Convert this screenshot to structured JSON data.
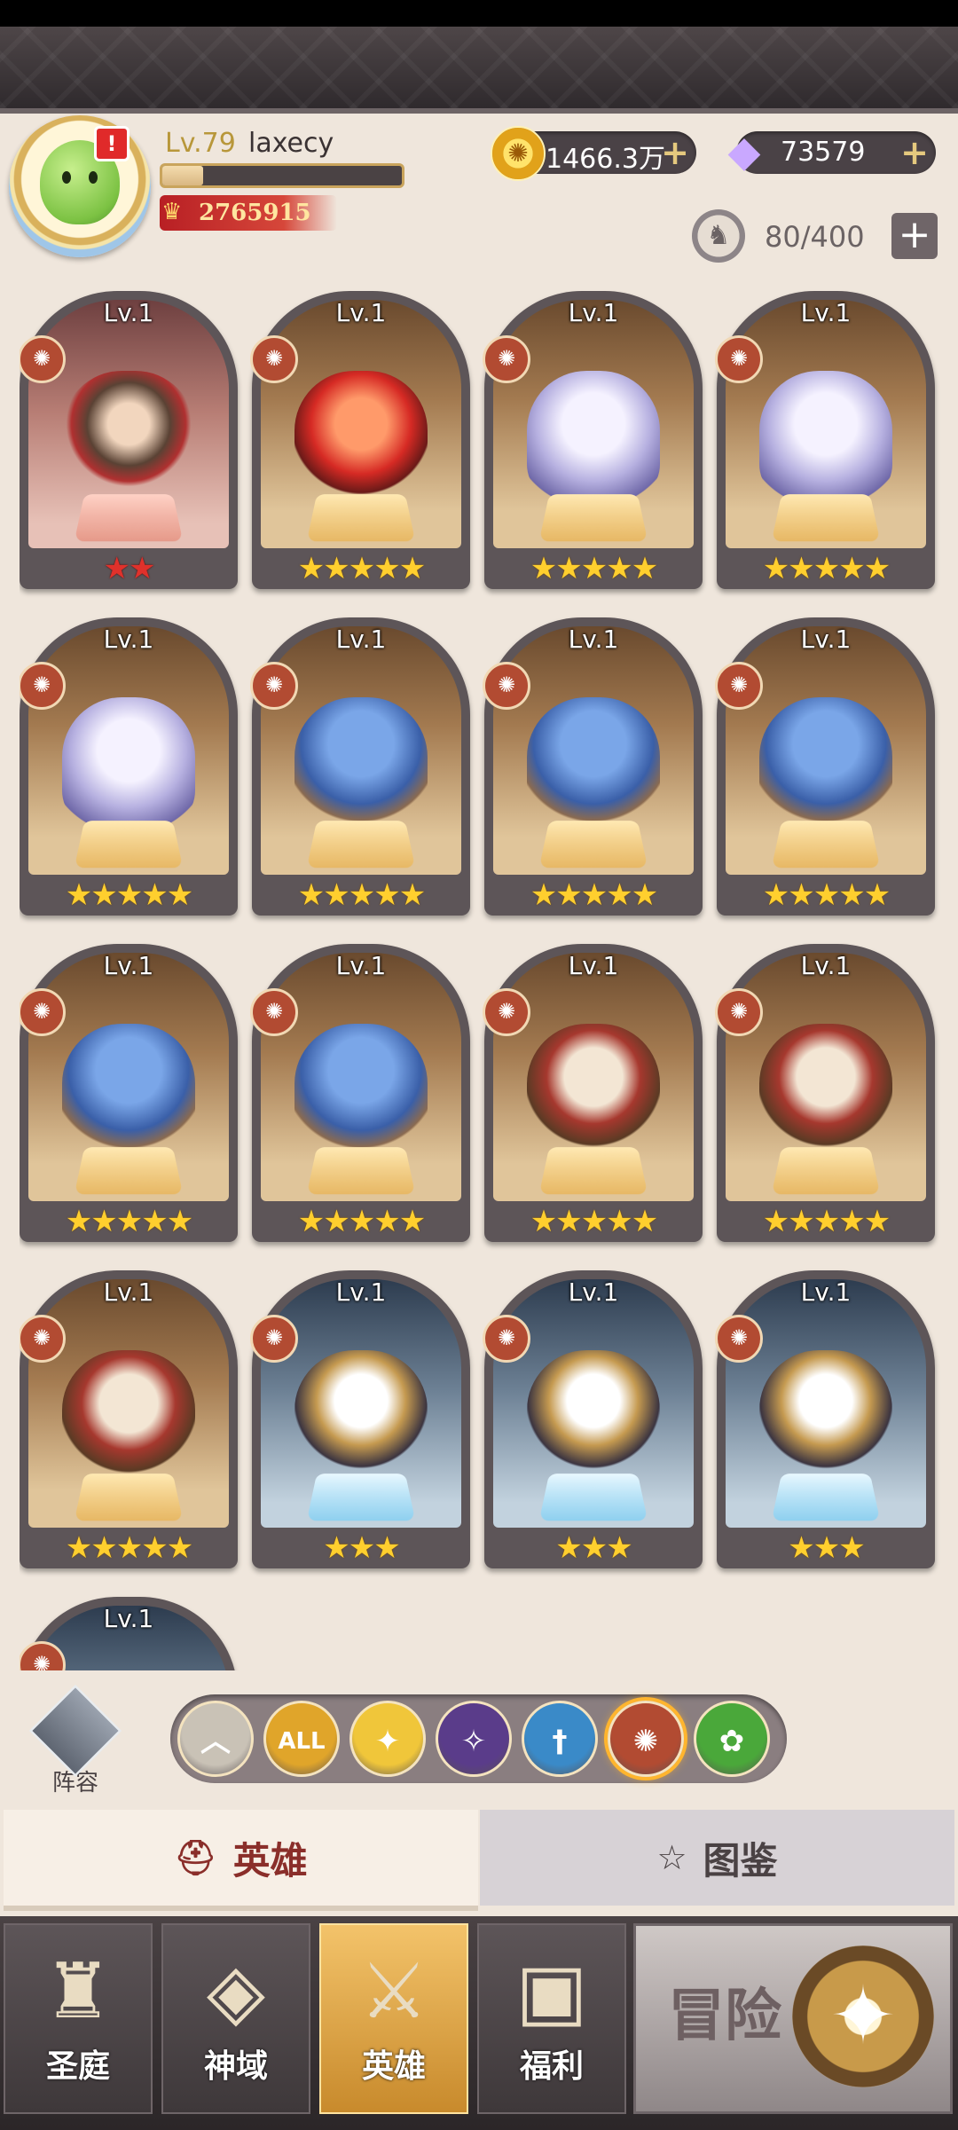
{
  "player": {
    "level": "Lv.79",
    "name": "laxecy",
    "power": "2765915",
    "alert": "!",
    "xp_fraction": 0.17
  },
  "currencies": {
    "gold": "1466.3万",
    "gems": "73579"
  },
  "capacity": "80/400",
  "heroes": [
    {
      "level": "Lv.1",
      "stars": "★★",
      "star_color": "red",
      "bg": "red",
      "sprite": "cat-girl"
    },
    {
      "level": "Lv.1",
      "stars": "★★★★★",
      "star_color": "gold",
      "bg": "brown",
      "sprite": "demon-girl"
    },
    {
      "level": "Lv.1",
      "stars": "★★★★★",
      "star_color": "gold",
      "bg": "brown",
      "sprite": "yeti"
    },
    {
      "level": "Lv.1",
      "stars": "★★★★★",
      "star_color": "gold",
      "bg": "brown",
      "sprite": "yeti"
    },
    {
      "level": "Lv.1",
      "stars": "★★★★★",
      "star_color": "gold",
      "bg": "brown",
      "sprite": "yeti"
    },
    {
      "level": "Lv.1",
      "stars": "★★★★★",
      "star_color": "gold",
      "bg": "brown",
      "sprite": "wolf"
    },
    {
      "level": "Lv.1",
      "stars": "★★★★★",
      "star_color": "gold",
      "bg": "brown",
      "sprite": "wolf"
    },
    {
      "level": "Lv.1",
      "stars": "★★★★★",
      "star_color": "gold",
      "bg": "brown",
      "sprite": "wolf"
    },
    {
      "level": "Lv.1",
      "stars": "★★★★★",
      "star_color": "gold",
      "bg": "brown",
      "sprite": "wolf"
    },
    {
      "level": "Lv.1",
      "stars": "★★★★★",
      "star_color": "gold",
      "bg": "brown",
      "sprite": "wolf"
    },
    {
      "level": "Lv.1",
      "stars": "★★★★★",
      "star_color": "gold",
      "bg": "brown",
      "sprite": "deer-shaman"
    },
    {
      "level": "Lv.1",
      "stars": "★★★★★",
      "star_color": "gold",
      "bg": "brown",
      "sprite": "deer-shaman"
    },
    {
      "level": "Lv.1",
      "stars": "★★★★★",
      "star_color": "gold",
      "bg": "brown",
      "sprite": "deer-shaman"
    },
    {
      "level": "Lv.1",
      "stars": "★★★",
      "star_color": "gold",
      "bg": "blue",
      "sprite": "eagle-warrior"
    },
    {
      "level": "Lv.1",
      "stars": "★★★",
      "star_color": "gold",
      "bg": "blue",
      "sprite": "eagle-warrior"
    },
    {
      "level": "Lv.1",
      "stars": "★★★",
      "star_color": "gold",
      "bg": "blue",
      "sprite": "eagle-warrior"
    },
    {
      "level": "Lv.1",
      "stars": "",
      "star_color": "gold",
      "bg": "blue",
      "sprite": "partial"
    }
  ],
  "formation_label": "阵容",
  "filters": [
    {
      "name": "up",
      "label": "︿",
      "color": "#c9c2b6",
      "selected": false
    },
    {
      "name": "all",
      "label": "ALL",
      "color": "#e0a52a",
      "selected": false
    },
    {
      "name": "light",
      "label": "✦",
      "color": "#f0c63a",
      "selected": false
    },
    {
      "name": "dark",
      "label": "✧",
      "color": "#5a3c8a",
      "selected": false
    },
    {
      "name": "holy",
      "label": "†",
      "color": "#3a8ac8",
      "selected": false
    },
    {
      "name": "beast",
      "label": "✺",
      "color": "#b24b32",
      "selected": true
    },
    {
      "name": "nature",
      "label": "✿",
      "color": "#4aa83a",
      "selected": false
    }
  ],
  "tabs": {
    "heroes": "英雄",
    "codex": "图鉴"
  },
  "nav": {
    "court": "圣庭",
    "divine": "神域",
    "heroes": "英雄",
    "welfare": "福利",
    "adventure": "冒险"
  },
  "icons": {
    "coin": "coin-icon",
    "gem": "diamond-icon",
    "power": "crown-icon",
    "capacity": "hero-capacity-icon",
    "class": "beast-class-icon"
  }
}
